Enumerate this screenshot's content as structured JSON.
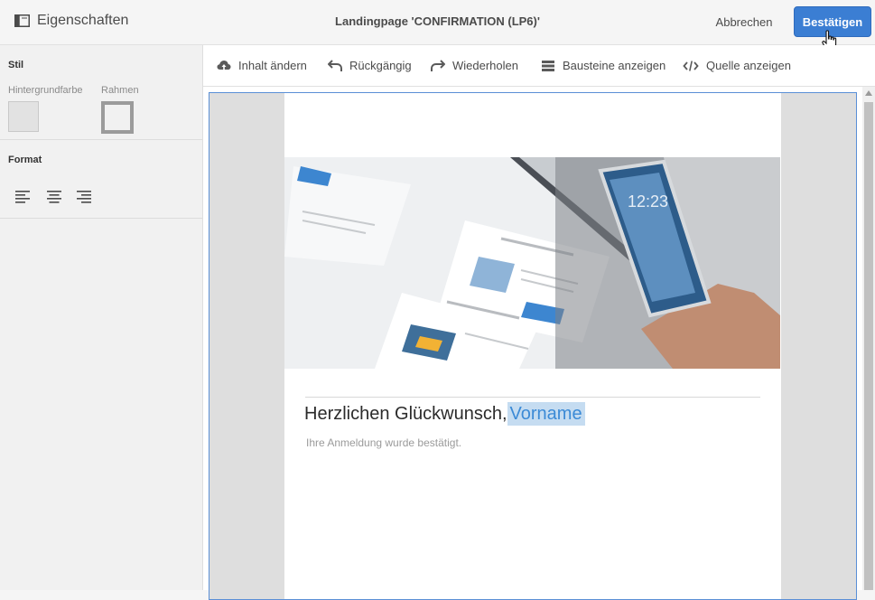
{
  "header": {
    "panel_label": "Eigenschaften",
    "title": "Landingpage 'CONFIRMATION (LP6)'",
    "cancel_label": "Abbrechen",
    "confirm_label": "Bestätigen"
  },
  "sidebar": {
    "stil_title": "Stil",
    "background_label": "Hintergrundfarbe",
    "border_label": "Rahmen",
    "format_title": "Format",
    "background_color": "#e2e2e2",
    "border_color": "#9b9b9b"
  },
  "toolbar": {
    "change_content": "Inhalt ändern",
    "undo": "Rückgängig",
    "redo": "Wiederholen",
    "show_blocks": "Bausteine anzeigen",
    "show_source": "Quelle anzeigen"
  },
  "content": {
    "headline_text": "Herzlichen Glückwunsch,",
    "headline_field": "Vorname",
    "subtext": "Ihre Anmeldung wurde bestätigt."
  },
  "colors": {
    "accent": "#3b7ed3",
    "frame_border": "#5a8fd6",
    "field_highlight": "#c5dcf1"
  }
}
